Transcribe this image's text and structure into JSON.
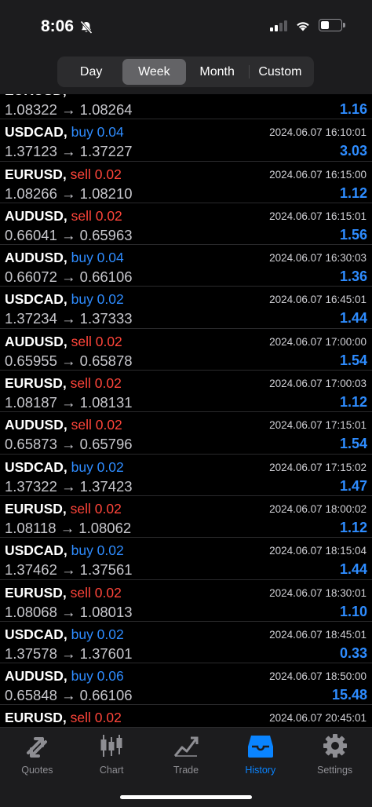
{
  "status": {
    "time": "8:06"
  },
  "segments": [
    "Day",
    "Week",
    "Month",
    "Custom"
  ],
  "active_segment": "Week",
  "deals": [
    {
      "symbol": "EURUSD,",
      "side": "sell",
      "volume": "",
      "prices": "1.08322 → 1.08264",
      "time": "",
      "profit": "1.16"
    },
    {
      "symbol": "USDCAD,",
      "side": "buy",
      "volume": "buy 0.04",
      "prices": "1.37123 → 1.37227",
      "time": "2024.06.07 16:10:01",
      "profit": "3.03"
    },
    {
      "symbol": "EURUSD,",
      "side": "sell",
      "volume": "sell 0.02",
      "prices": "1.08266 → 1.08210",
      "time": "2024.06.07 16:15:00",
      "profit": "1.12"
    },
    {
      "symbol": "AUDUSD,",
      "side": "sell",
      "volume": "sell 0.02",
      "prices": "0.66041 → 0.65963",
      "time": "2024.06.07 16:15:01",
      "profit": "1.56"
    },
    {
      "symbol": "AUDUSD,",
      "side": "buy",
      "volume": "buy 0.04",
      "prices": "0.66072 → 0.66106",
      "time": "2024.06.07 16:30:03",
      "profit": "1.36"
    },
    {
      "symbol": "USDCAD,",
      "side": "buy",
      "volume": "buy 0.02",
      "prices": "1.37234 → 1.37333",
      "time": "2024.06.07 16:45:01",
      "profit": "1.44"
    },
    {
      "symbol": "AUDUSD,",
      "side": "sell",
      "volume": "sell 0.02",
      "prices": "0.65955 → 0.65878",
      "time": "2024.06.07 17:00:00",
      "profit": "1.54"
    },
    {
      "symbol": "EURUSD,",
      "side": "sell",
      "volume": "sell 0.02",
      "prices": "1.08187 → 1.08131",
      "time": "2024.06.07 17:00:03",
      "profit": "1.12"
    },
    {
      "symbol": "AUDUSD,",
      "side": "sell",
      "volume": "sell 0.02",
      "prices": "0.65873 → 0.65796",
      "time": "2024.06.07 17:15:01",
      "profit": "1.54"
    },
    {
      "symbol": "USDCAD,",
      "side": "buy",
      "volume": "buy 0.02",
      "prices": "1.37322 → 1.37423",
      "time": "2024.06.07 17:15:02",
      "profit": "1.47"
    },
    {
      "symbol": "EURUSD,",
      "side": "sell",
      "volume": "sell 0.02",
      "prices": "1.08118 → 1.08062",
      "time": "2024.06.07 18:00:02",
      "profit": "1.12"
    },
    {
      "symbol": "USDCAD,",
      "side": "buy",
      "volume": "buy 0.02",
      "prices": "1.37462 → 1.37561",
      "time": "2024.06.07 18:15:04",
      "profit": "1.44"
    },
    {
      "symbol": "EURUSD,",
      "side": "sell",
      "volume": "sell 0.02",
      "prices": "1.08068 → 1.08013",
      "time": "2024.06.07 18:30:01",
      "profit": "1.10"
    },
    {
      "symbol": "USDCAD,",
      "side": "buy",
      "volume": "buy 0.02",
      "prices": "1.37578 → 1.37601",
      "time": "2024.06.07 18:45:01",
      "profit": "0.33"
    },
    {
      "symbol": "AUDUSD,",
      "side": "buy",
      "volume": "buy 0.06",
      "prices": "0.65848 → 0.66106",
      "time": "2024.06.07 18:50:00",
      "profit": "15.48"
    },
    {
      "symbol": "EURUSD,",
      "side": "sell",
      "volume": "sell 0.02",
      "prices": "",
      "time": "2024.06.07 20:45:01",
      "profit": ""
    }
  ],
  "tabs": [
    {
      "label": "Quotes",
      "icon": "quotes-arrows-icon"
    },
    {
      "label": "Chart",
      "icon": "candlestick-chart-icon"
    },
    {
      "label": "Trade",
      "icon": "trade-chart-icon"
    },
    {
      "label": "History",
      "icon": "history-inbox-icon"
    },
    {
      "label": "Settings",
      "icon": "gear-icon"
    }
  ],
  "active_tab": "History",
  "colors": {
    "buy": "#2e8cff",
    "sell": "#ff453a",
    "profit": "#2e8cff",
    "active_tab": "#0a84ff"
  }
}
